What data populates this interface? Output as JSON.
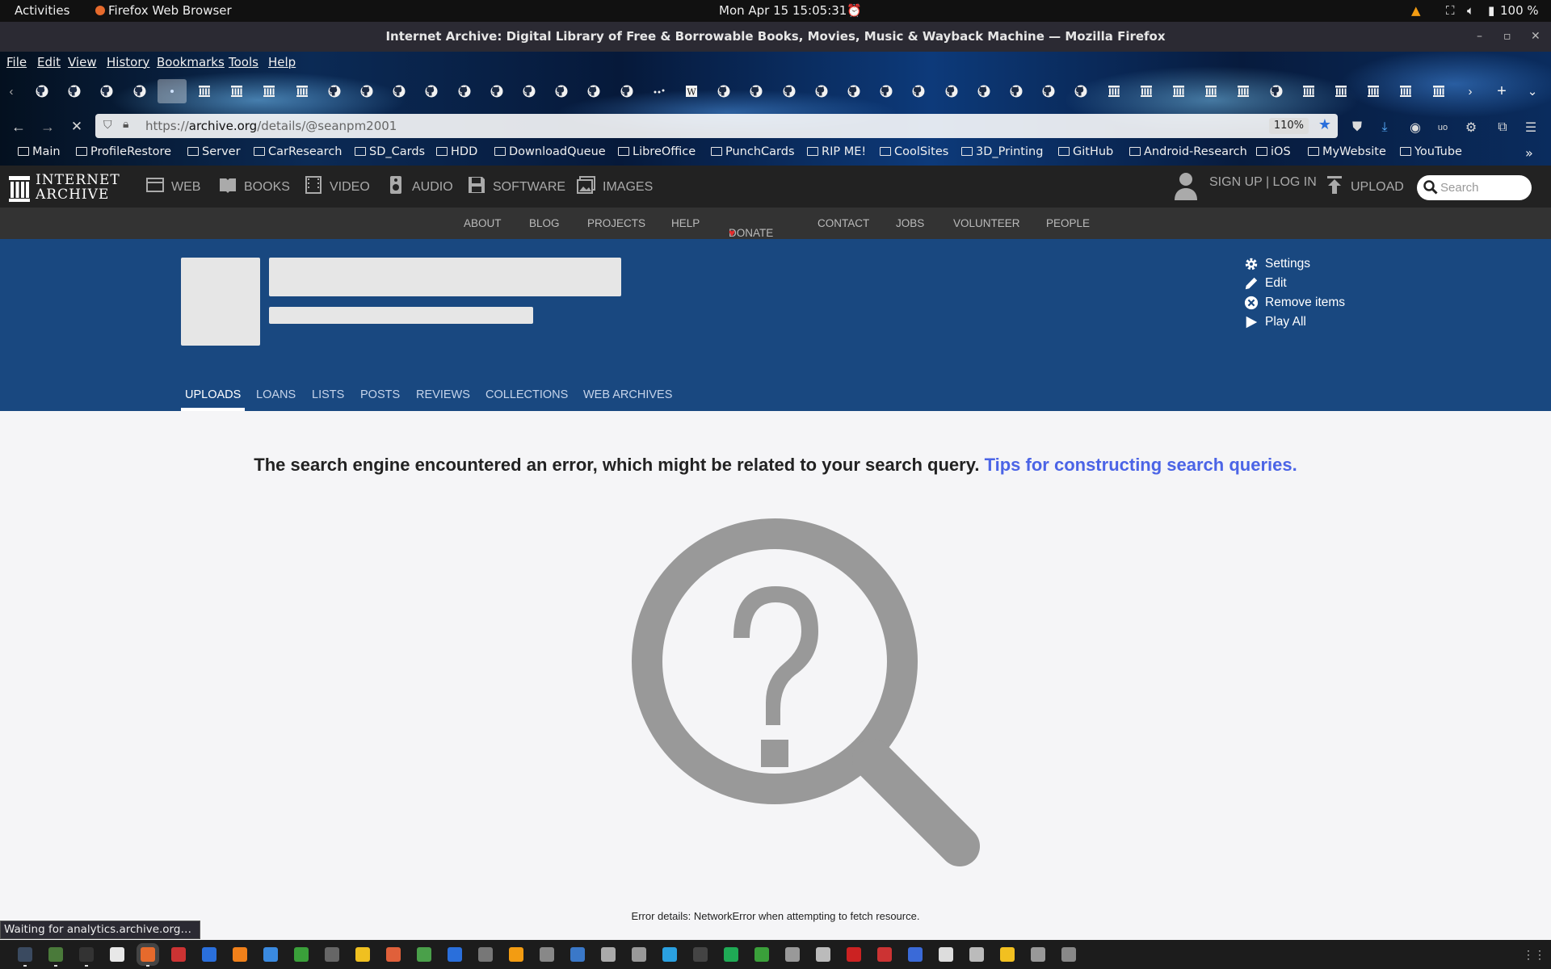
{
  "system_bar": {
    "activities": "Activities",
    "app_name": "Firefox Web Browser",
    "datetime": "Mon Apr 15  15:05:31",
    "battery": "100 %"
  },
  "window": {
    "title": "Internet Archive: Digital Library of Free & Borrowable Books, Movies, Music & Wayback Machine — Mozilla Firefox"
  },
  "menu": [
    "File",
    "Edit",
    "View",
    "History",
    "Bookmarks",
    "Tools",
    "Help"
  ],
  "tabs": {
    "icons": [
      "github",
      "github",
      "github",
      "github",
      "active-page",
      "archive",
      "archive",
      "archive",
      "archive",
      "github",
      "github",
      "github",
      "github",
      "github",
      "github",
      "github",
      "github",
      "github",
      "github",
      "dots",
      "wikipedia",
      "github",
      "github",
      "github",
      "github",
      "github",
      "github",
      "github",
      "github",
      "github",
      "github",
      "github",
      "github",
      "archive",
      "archive",
      "archive",
      "archive",
      "archive",
      "github",
      "archive",
      "archive",
      "archive",
      "archive",
      "archive"
    ]
  },
  "urlbar": {
    "url_prefix": "https://",
    "url_host": "archive.org",
    "url_path": "/details/@seanpm2001",
    "zoom": "110%"
  },
  "bookmarks": [
    "Main",
    "ProfileRestore",
    "Server",
    "CarResearch",
    "SD_Cards",
    "HDD",
    "DownloadQueue",
    "LibreOffice",
    "PunchCards",
    "RIP ME!",
    "CoolSites",
    "3D_Printing",
    "GitHub",
    "Android-Research",
    "iOS",
    "MyWebsite",
    "YouTube"
  ],
  "ia_header": {
    "logo_line1": "INTERNET",
    "logo_line2": "ARCHIVE",
    "media": [
      "WEB",
      "BOOKS",
      "VIDEO",
      "AUDIO",
      "SOFTWARE",
      "IMAGES"
    ],
    "signup": "SIGN UP | LOG IN",
    "upload": "UPLOAD",
    "search_placeholder": "Search"
  },
  "ia_subnav": [
    "ABOUT",
    "BLOG",
    "PROJECTS",
    "HELP",
    "DONATE",
    "CONTACT",
    "JOBS",
    "VOLUNTEER",
    "PEOPLE"
  ],
  "profile": {
    "actions": [
      "Settings",
      "Edit",
      "Remove items",
      "Play All"
    ],
    "tabs": [
      "UPLOADS",
      "LOANS",
      "LISTS",
      "POSTS",
      "REVIEWS",
      "COLLECTIONS",
      "WEB ARCHIVES"
    ],
    "selected_tab": "UPLOADS"
  },
  "error": {
    "message": "The search engine encountered an error, which might be related to your search query.",
    "tips_link": "Tips for constructing search queries.",
    "details": "Error details: NetworkError when attempting to fetch resource."
  },
  "status_text": "Waiting for analytics.archive.org…",
  "colors": {
    "ia_blue": "#194880",
    "link": "#4b64e6",
    "header_dark": "#222222",
    "subnav": "#333333",
    "donate_heart": "#e42b2b"
  }
}
